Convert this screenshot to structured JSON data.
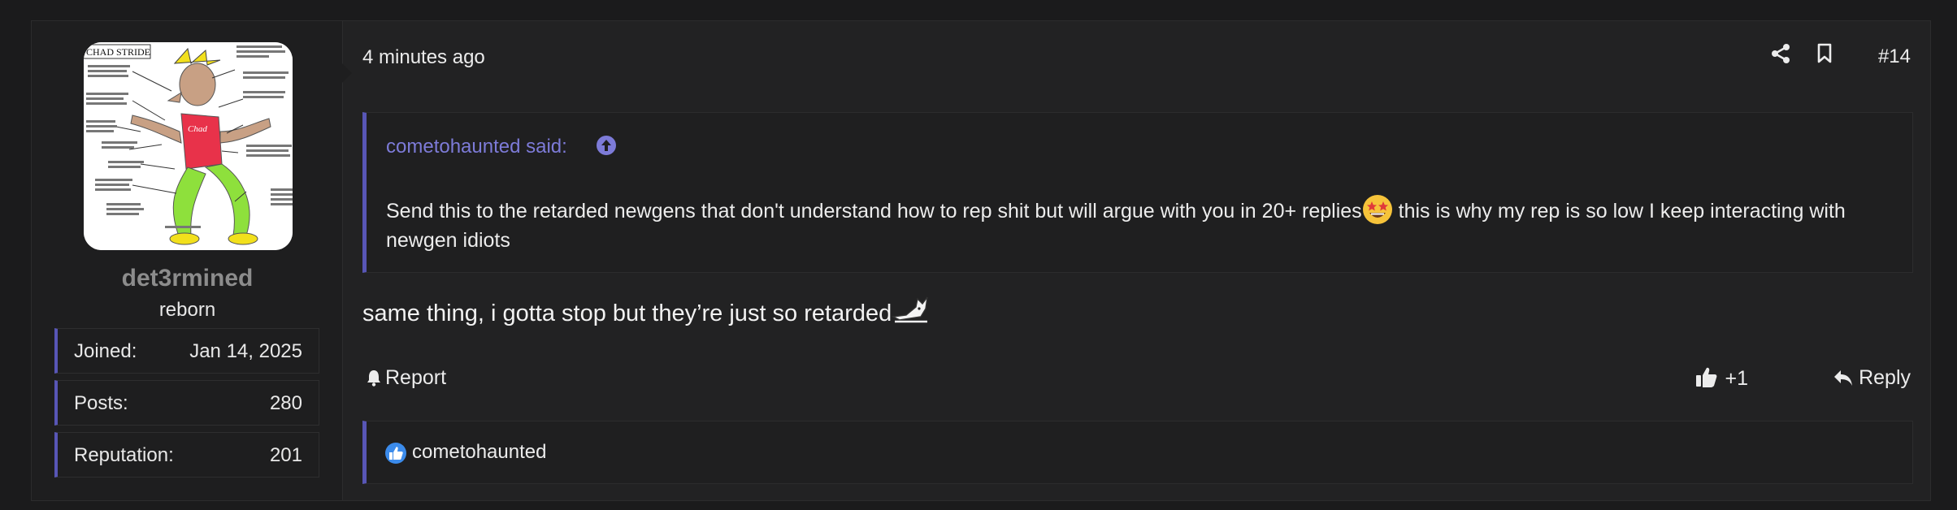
{
  "user": {
    "username": "det3rmined",
    "title": "reborn",
    "avatar": {
      "caption": "CHAD STRIDE",
      "shirt_text": "Chad"
    },
    "stats": [
      {
        "label": "Joined:",
        "value": "Jan 14, 2025"
      },
      {
        "label": "Posts:",
        "value": "280"
      },
      {
        "label": "Reputation:",
        "value": "201"
      }
    ]
  },
  "post": {
    "time": "4 minutes ago",
    "number": "#14",
    "header_icons": [
      "share-icon",
      "bookmark-icon"
    ],
    "quote": {
      "author": "cometohaunted said:",
      "text_before_emoji": "Send this to the retarded newgens that don't understand how to rep shit but will argue with you in 20+ replies",
      "text_after_emoji": " this is why my rep is so low I keep interacting with newgen idiots",
      "emoji": "grinning-face-with-star-eyes"
    },
    "message": "same thing, i gotta stop but they’re just so retarded",
    "actions": {
      "report": "Report",
      "react": "+1",
      "reply": "Reply"
    },
    "reactions": {
      "icon": "thumbs-up-icon",
      "users": "cometohaunted"
    }
  },
  "colors": {
    "accent": "#5856b6",
    "quote_author": "#7d7bd8",
    "background": "#1b1b1c",
    "panel": "#222223"
  }
}
